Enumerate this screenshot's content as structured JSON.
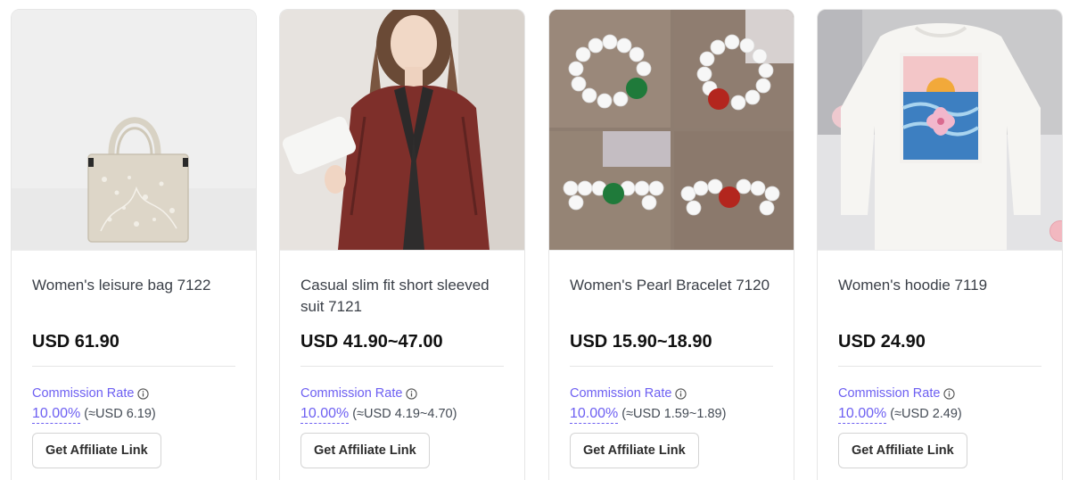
{
  "products": [
    {
      "title": "Women's leisure bag 7122",
      "price": "USD 61.90",
      "commission_label": "Commission Rate",
      "rate": "10.00%",
      "approx": "(≈USD 6.19)",
      "button": "Get Affiliate Link",
      "image_icon": "handbag-image"
    },
    {
      "title": "Casual slim fit short sleeved suit 7121",
      "price": "USD 41.90~47.00",
      "commission_label": "Commission Rate",
      "rate": "10.00%",
      "approx": "(≈USD 4.19~4.70)",
      "button": "Get Affiliate Link",
      "image_icon": "blazer-model-image"
    },
    {
      "title": "Women's Pearl Bracelet 7120",
      "price": "USD 15.90~18.90",
      "commission_label": "Commission Rate",
      "rate": "10.00%",
      "approx": "(≈USD 1.59~1.89)",
      "button": "Get Affiliate Link",
      "image_icon": "pearl-bracelet-image"
    },
    {
      "title": "Women's hoodie 7119",
      "price": "USD 24.90",
      "commission_label": "Commission Rate",
      "rate": "10.00%",
      "approx": "(≈USD 2.49)",
      "button": "Get Affiliate Link",
      "image_icon": "hoodie-image"
    }
  ],
  "colors": {
    "accent": "#6d5ff2",
    "price": "#111111",
    "border": "#e6e6e6"
  }
}
